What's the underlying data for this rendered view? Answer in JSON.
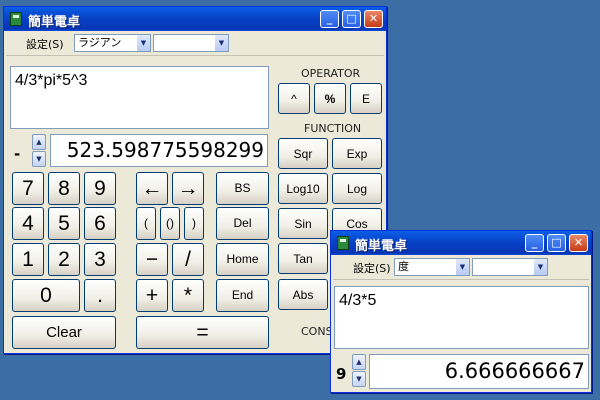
{
  "main_window": {
    "title": "簡単電卓",
    "menu_settings": "設定(S)",
    "angle_mode": "ラジアン",
    "second_dropdown": "",
    "expression": "4/3*pi*5^3",
    "sign": "-",
    "result": "523.598775598299",
    "operator_label": "OPERATOR",
    "function_label": "FUNCTION",
    "constant_label_partial": "CONS",
    "keypad": {
      "d7": "7",
      "d8": "8",
      "d9": "9",
      "d4": "4",
      "d5": "5",
      "d6": "6",
      "d1": "1",
      "d2": "2",
      "d3": "3",
      "d0": "0",
      "dot": ".",
      "clear": "Clear"
    },
    "ops": {
      "left": "←",
      "right": "→",
      "bs": "BS",
      "lparen": "(",
      "parens": "()",
      "rparen": ")",
      "del": "Del",
      "minus": "−",
      "divide": "/",
      "home": "Home",
      "plus": "+",
      "multiply": "*",
      "end": "End",
      "equals": "="
    },
    "operator_buttons": [
      "^",
      "%",
      "E"
    ],
    "function_buttons": [
      "Sqr",
      "Exp",
      "Log10",
      "Log",
      "Sin",
      "Cos",
      "Tan",
      "",
      "Abs",
      ""
    ]
  },
  "second_window": {
    "title": "簡単電卓",
    "menu_settings": "設定(S)",
    "angle_mode": "度",
    "second_dropdown": "",
    "expression": "4/3*5",
    "sign": "9",
    "result": "6.666666667"
  },
  "colors": {
    "desktop": "#3a6ea5",
    "titlebar": "#0842c8",
    "window_face": "#ece9d8",
    "button_border": "#003c74"
  }
}
